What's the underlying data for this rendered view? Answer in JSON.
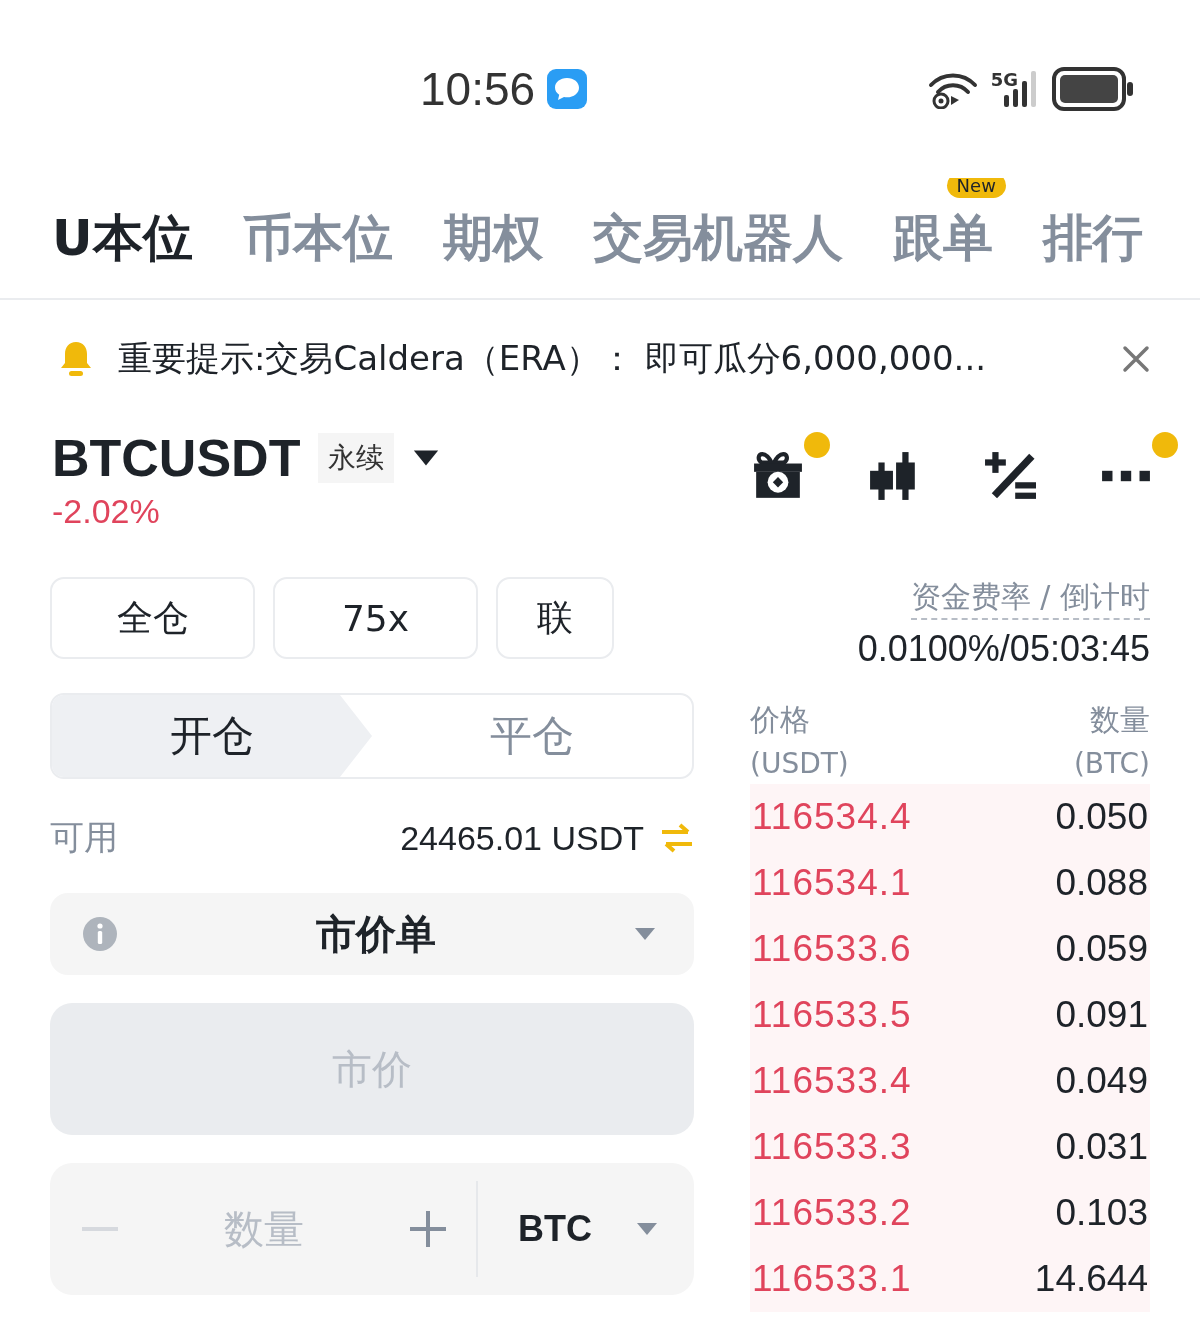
{
  "status_bar": {
    "time": "10:56",
    "network": "5G"
  },
  "nav_tabs": [
    {
      "label": "U本位",
      "selected": true
    },
    {
      "label": "币本位",
      "selected": false
    },
    {
      "label": "期权",
      "selected": false
    },
    {
      "label": "交易机器人",
      "selected": false
    },
    {
      "label": "跟单",
      "selected": false,
      "badge": "New"
    },
    {
      "label": "排行",
      "selected": false
    }
  ],
  "notice": {
    "text": "重要提示:交易Caldera（ERA）： 即可瓜分6,000,000..."
  },
  "ticker": {
    "symbol": "BTCUSDT",
    "tag": "永续",
    "change": "-2.02%"
  },
  "toolbar": [
    {
      "kind": "gift",
      "dot": true
    },
    {
      "kind": "candles"
    },
    {
      "kind": "calculator"
    },
    {
      "kind": "more",
      "dot": true
    }
  ],
  "margin_buttons": [
    "全仓",
    "75x",
    "联"
  ],
  "order_tabs": [
    {
      "label": "开仓",
      "selected": true
    },
    {
      "label": "平仓",
      "selected": false
    }
  ],
  "available": {
    "label": "可用",
    "value": "24465.01 USDT"
  },
  "order_type": {
    "value": "市价单"
  },
  "price_field": {
    "placeholder": "市价"
  },
  "quantity_field": {
    "placeholder": "数量",
    "unit": "BTC"
  },
  "funding": {
    "label": "资金费率 / 倒计时",
    "value": "0.0100%/05:03:45"
  },
  "order_book": {
    "columns": [
      {
        "title": "价格",
        "unit": "(USDT)"
      },
      {
        "title": "数量",
        "unit": "(BTC)"
      }
    ],
    "asks": [
      {
        "price": "116534.4",
        "amount": "0.050"
      },
      {
        "price": "116534.1",
        "amount": "0.088"
      },
      {
        "price": "116533.6",
        "amount": "0.059"
      },
      {
        "price": "116533.5",
        "amount": "0.091"
      },
      {
        "price": "116533.4",
        "amount": "0.049"
      },
      {
        "price": "116533.3",
        "amount": "0.031"
      },
      {
        "price": "116533.2",
        "amount": "0.103"
      },
      {
        "price": "116533.1",
        "amount": "14.644"
      }
    ]
  }
}
